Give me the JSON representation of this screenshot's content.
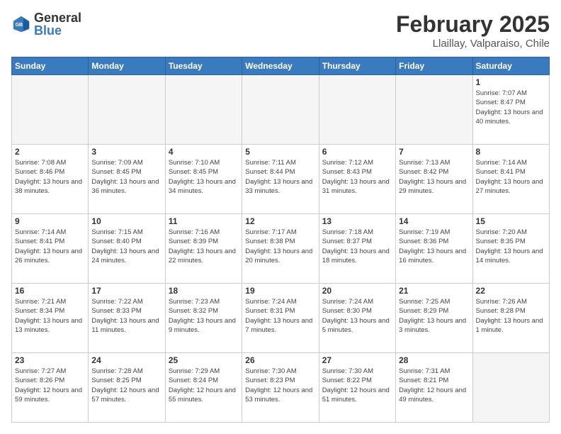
{
  "header": {
    "logo": {
      "general": "General",
      "blue": "Blue"
    },
    "title": "February 2025",
    "subtitle": "Llaillay, Valparaiso, Chile"
  },
  "weekdays": [
    "Sunday",
    "Monday",
    "Tuesday",
    "Wednesday",
    "Thursday",
    "Friday",
    "Saturday"
  ],
  "weeks": [
    [
      {
        "day": "",
        "info": ""
      },
      {
        "day": "",
        "info": ""
      },
      {
        "day": "",
        "info": ""
      },
      {
        "day": "",
        "info": ""
      },
      {
        "day": "",
        "info": ""
      },
      {
        "day": "",
        "info": ""
      },
      {
        "day": "1",
        "info": "Sunrise: 7:07 AM\nSunset: 8:47 PM\nDaylight: 13 hours and 40 minutes."
      }
    ],
    [
      {
        "day": "2",
        "info": "Sunrise: 7:08 AM\nSunset: 8:46 PM\nDaylight: 13 hours and 38 minutes."
      },
      {
        "day": "3",
        "info": "Sunrise: 7:09 AM\nSunset: 8:45 PM\nDaylight: 13 hours and 36 minutes."
      },
      {
        "day": "4",
        "info": "Sunrise: 7:10 AM\nSunset: 8:45 PM\nDaylight: 13 hours and 34 minutes."
      },
      {
        "day": "5",
        "info": "Sunrise: 7:11 AM\nSunset: 8:44 PM\nDaylight: 13 hours and 33 minutes."
      },
      {
        "day": "6",
        "info": "Sunrise: 7:12 AM\nSunset: 8:43 PM\nDaylight: 13 hours and 31 minutes."
      },
      {
        "day": "7",
        "info": "Sunrise: 7:13 AM\nSunset: 8:42 PM\nDaylight: 13 hours and 29 minutes."
      },
      {
        "day": "8",
        "info": "Sunrise: 7:14 AM\nSunset: 8:41 PM\nDaylight: 13 hours and 27 minutes."
      }
    ],
    [
      {
        "day": "9",
        "info": "Sunrise: 7:14 AM\nSunset: 8:41 PM\nDaylight: 13 hours and 26 minutes."
      },
      {
        "day": "10",
        "info": "Sunrise: 7:15 AM\nSunset: 8:40 PM\nDaylight: 13 hours and 24 minutes."
      },
      {
        "day": "11",
        "info": "Sunrise: 7:16 AM\nSunset: 8:39 PM\nDaylight: 13 hours and 22 minutes."
      },
      {
        "day": "12",
        "info": "Sunrise: 7:17 AM\nSunset: 8:38 PM\nDaylight: 13 hours and 20 minutes."
      },
      {
        "day": "13",
        "info": "Sunrise: 7:18 AM\nSunset: 8:37 PM\nDaylight: 13 hours and 18 minutes."
      },
      {
        "day": "14",
        "info": "Sunrise: 7:19 AM\nSunset: 8:36 PM\nDaylight: 13 hours and 16 minutes."
      },
      {
        "day": "15",
        "info": "Sunrise: 7:20 AM\nSunset: 8:35 PM\nDaylight: 13 hours and 14 minutes."
      }
    ],
    [
      {
        "day": "16",
        "info": "Sunrise: 7:21 AM\nSunset: 8:34 PM\nDaylight: 13 hours and 13 minutes."
      },
      {
        "day": "17",
        "info": "Sunrise: 7:22 AM\nSunset: 8:33 PM\nDaylight: 13 hours and 11 minutes."
      },
      {
        "day": "18",
        "info": "Sunrise: 7:23 AM\nSunset: 8:32 PM\nDaylight: 13 hours and 9 minutes."
      },
      {
        "day": "19",
        "info": "Sunrise: 7:24 AM\nSunset: 8:31 PM\nDaylight: 13 hours and 7 minutes."
      },
      {
        "day": "20",
        "info": "Sunrise: 7:24 AM\nSunset: 8:30 PM\nDaylight: 13 hours and 5 minutes."
      },
      {
        "day": "21",
        "info": "Sunrise: 7:25 AM\nSunset: 8:29 PM\nDaylight: 13 hours and 3 minutes."
      },
      {
        "day": "22",
        "info": "Sunrise: 7:26 AM\nSunset: 8:28 PM\nDaylight: 13 hours and 1 minute."
      }
    ],
    [
      {
        "day": "23",
        "info": "Sunrise: 7:27 AM\nSunset: 8:26 PM\nDaylight: 12 hours and 59 minutes."
      },
      {
        "day": "24",
        "info": "Sunrise: 7:28 AM\nSunset: 8:25 PM\nDaylight: 12 hours and 57 minutes."
      },
      {
        "day": "25",
        "info": "Sunrise: 7:29 AM\nSunset: 8:24 PM\nDaylight: 12 hours and 55 minutes."
      },
      {
        "day": "26",
        "info": "Sunrise: 7:30 AM\nSunset: 8:23 PM\nDaylight: 12 hours and 53 minutes."
      },
      {
        "day": "27",
        "info": "Sunrise: 7:30 AM\nSunset: 8:22 PM\nDaylight: 12 hours and 51 minutes."
      },
      {
        "day": "28",
        "info": "Sunrise: 7:31 AM\nSunset: 8:21 PM\nDaylight: 12 hours and 49 minutes."
      },
      {
        "day": "",
        "info": ""
      }
    ]
  ]
}
